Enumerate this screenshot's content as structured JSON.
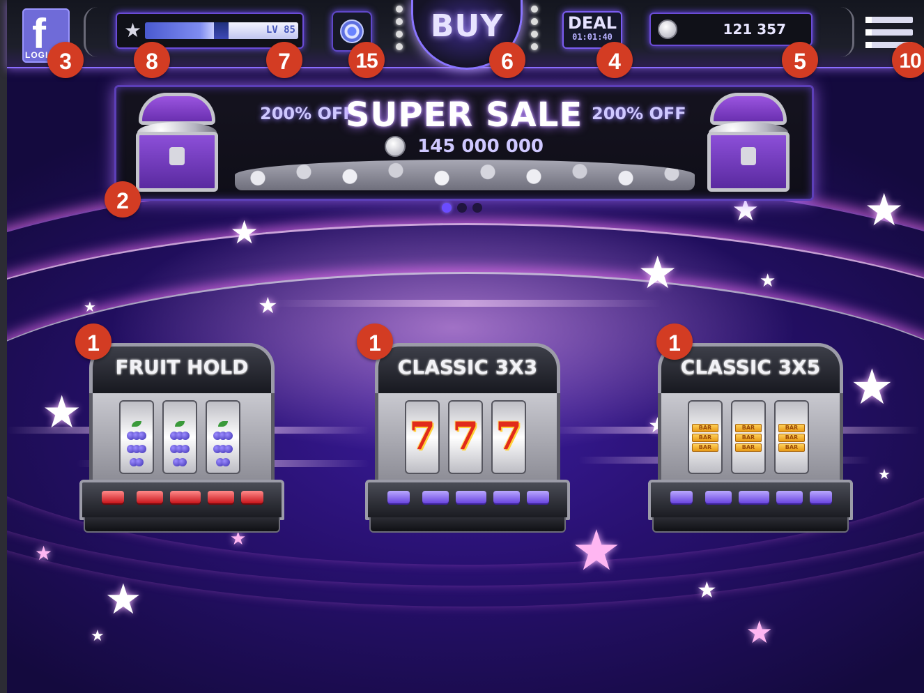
{
  "header": {
    "facebook_login": {
      "icon": "facebook-icon",
      "label": "LOGIN"
    },
    "level": {
      "label": "LV 85",
      "icon": "star-icon",
      "progress": 0.45
    },
    "bonus_wheel": {
      "icon": "wheel-icon"
    },
    "buy_label": "BUY",
    "deal": {
      "label": "DEAL",
      "timer": "01:01:40"
    },
    "coins": {
      "icon": "coin-icon",
      "balance": "121 357"
    },
    "menu": {
      "icon": "hamburger-menu-icon"
    }
  },
  "banner": {
    "discount_left": "200% OFF",
    "title": "SUPER SALE",
    "discount_right": "200% OFF",
    "coin_amount": "145 000 000",
    "page_count": 3,
    "active_page": 1
  },
  "machines": [
    {
      "name": "FRUIT HOLD",
      "symbol": "grapes",
      "button_color": "#d31d22"
    },
    {
      "name": "CLASSIC 3X3",
      "symbol": "seven",
      "button_color": "#6d49e3"
    },
    {
      "name": "CLASSIC 3X5",
      "symbol": "bar",
      "button_color": "#6d49e3"
    }
  ],
  "badges": {
    "facebook": "3",
    "level_star": "8",
    "level_bar": "7",
    "wheel": "15",
    "buy": "6",
    "deal": "4",
    "coins": "5",
    "menu": "10",
    "banner": "2",
    "machine_1": "1",
    "machine_2": "1",
    "machine_3": "1"
  },
  "symbols": {
    "seven": "7",
    "bar": "BAR"
  },
  "colors": {
    "accent": "#8a6dff",
    "badge": "#d33c23",
    "background": "#27106e"
  }
}
